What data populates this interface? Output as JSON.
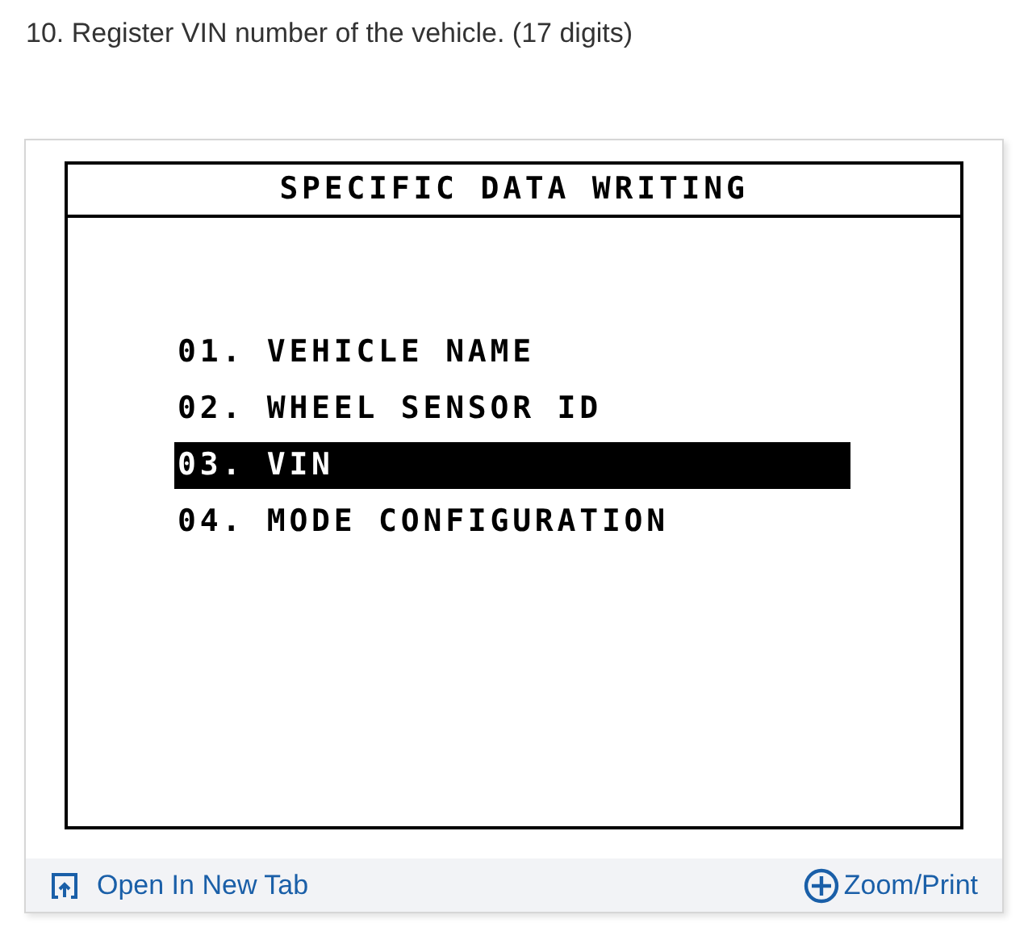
{
  "caption": "10. Register VIN number of the vehicle. (17 digits)",
  "screen": {
    "title": "SPECIFIC DATA WRITING",
    "items": [
      {
        "label": "01. VEHICLE NAME",
        "selected": false
      },
      {
        "label": "02. WHEEL SENSOR ID",
        "selected": false
      },
      {
        "label": "03. VIN",
        "selected": true
      },
      {
        "label": "04. MODE CONFIGURATION",
        "selected": false
      }
    ]
  },
  "footer": {
    "open_link": "Open In New Tab",
    "zoom_link": "Zoom/Print"
  }
}
